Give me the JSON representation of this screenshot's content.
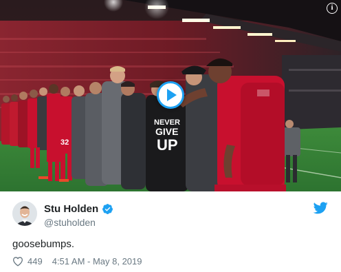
{
  "media": {
    "shirt_text_line1": "NEVER",
    "shirt_text_line2": "GIVE",
    "shirt_text_line3": "UP",
    "shirt_number": "32",
    "play_icon": "play-icon",
    "info_icon": "info-icon",
    "info_label": "i"
  },
  "tweet": {
    "author_name": "Stu Holden",
    "author_handle": "@stuholden",
    "text": "goosebumps.",
    "like_count": "449",
    "timestamp": "4:51 AM - May 8, 2019",
    "verified_icon": "verified-badge-icon",
    "bird_icon": "twitter-bird-icon",
    "heart_icon": "heart-icon"
  },
  "colors": {
    "twitter_blue": "#1da1f2",
    "text_primary": "#1c2022",
    "text_secondary": "#697882",
    "liverpool_red": "#c8102e"
  }
}
